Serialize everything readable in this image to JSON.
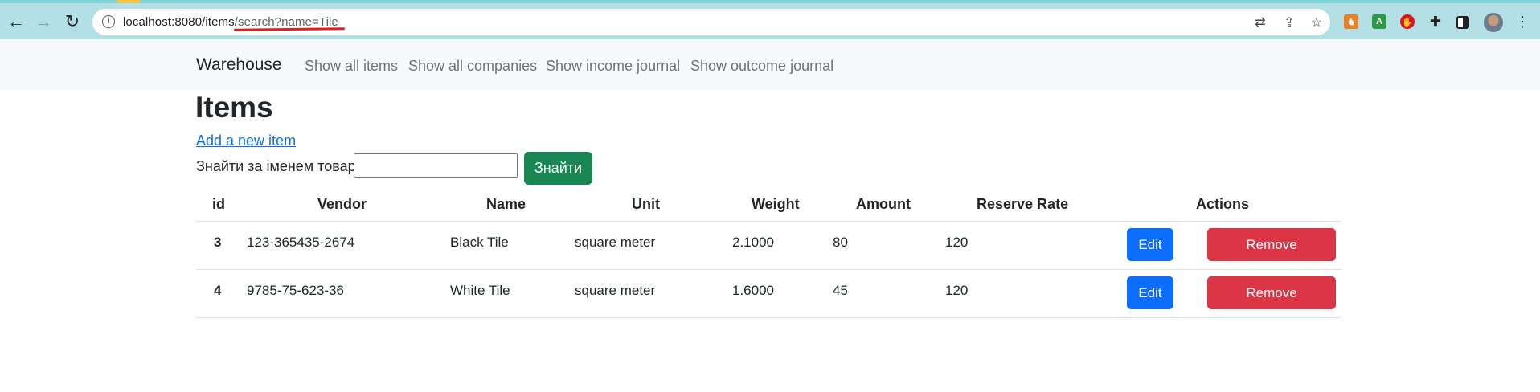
{
  "browser": {
    "url_host": "localhost:8080/items",
    "url_path": "/search?name=Tile",
    "extensions": [
      "extension-1-icon",
      "extension-2-icon",
      "extension-3-icon",
      "puzzle-icon",
      "side-panel-icon"
    ]
  },
  "navbar": {
    "brand": "Warehouse",
    "links": [
      "Show all items",
      "Show all companies",
      "Show income journal",
      "Show outcome journal"
    ]
  },
  "page": {
    "title": "Items",
    "add_link": "Add a new item",
    "search": {
      "label": "Знайти за іменем товар",
      "value": "",
      "button": "Знайти"
    }
  },
  "table": {
    "headers": [
      "id",
      "Vendor",
      "Name",
      "Unit",
      "Weight",
      "Amount",
      "Reserve Rate",
      "Actions"
    ],
    "rows": [
      {
        "id": "3",
        "vendor": "123-365435-2674",
        "name": "Black Tile",
        "unit": "square meter",
        "weight": "2.1000",
        "amount": "80",
        "reserve_rate": "120"
      },
      {
        "id": "4",
        "vendor": "9785-75-623-36",
        "name": "White Tile",
        "unit": "square meter",
        "weight": "1.6000",
        "amount": "45",
        "reserve_rate": "120"
      }
    ],
    "edit_label": "Edit",
    "remove_label": "Remove"
  },
  "colors": {
    "success": "#198754",
    "primary": "#0d6efd",
    "danger": "#dc3545",
    "chrome": "#b3e0e4"
  }
}
